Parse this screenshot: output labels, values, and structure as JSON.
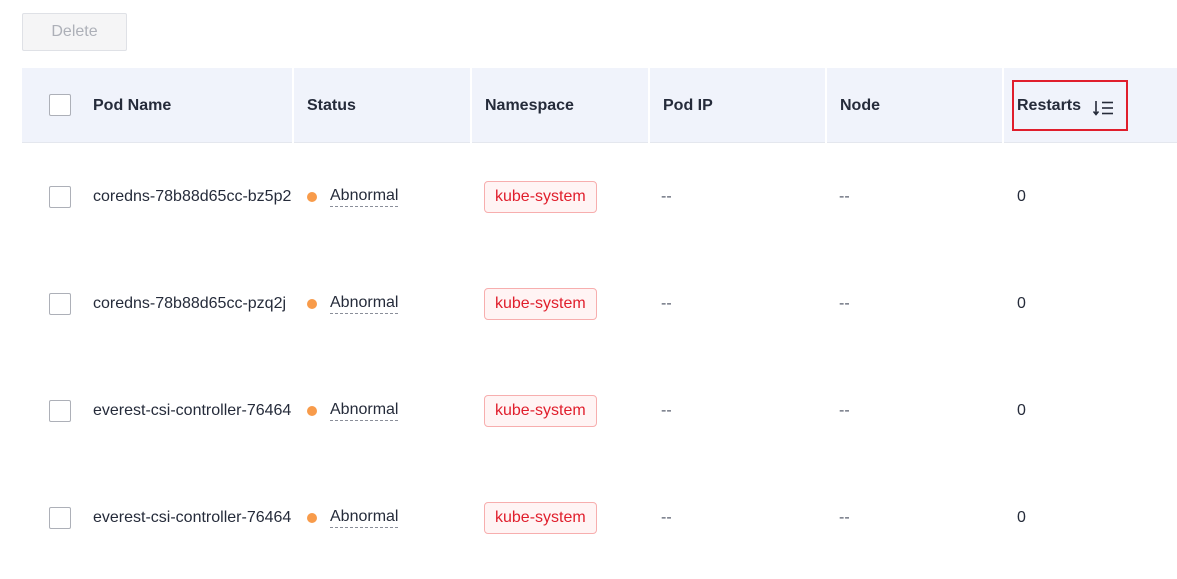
{
  "toolbar": {
    "delete_label": "Delete"
  },
  "table": {
    "columns": [
      "Pod Name",
      "Status",
      "Namespace",
      "Pod IP",
      "Node",
      "Restarts"
    ],
    "rows": [
      {
        "name": "coredns-78b88d65cc-bz5p2",
        "status": "Abnormal",
        "namespace": "kube-system",
        "pod_ip": "--",
        "node": "--",
        "restarts": "0"
      },
      {
        "name": "coredns-78b88d65cc-pzq2j",
        "status": "Abnormal",
        "namespace": "kube-system",
        "pod_ip": "--",
        "node": "--",
        "restarts": "0"
      },
      {
        "name": "everest-csi-controller-76464",
        "status": "Abnormal",
        "namespace": "kube-system",
        "pod_ip": "--",
        "node": "--",
        "restarts": "0"
      },
      {
        "name": "everest-csi-controller-76464",
        "status": "Abnormal",
        "namespace": "kube-system",
        "pod_ip": "--",
        "node": "--",
        "restarts": "0"
      }
    ]
  },
  "colors": {
    "abnormal_dot": "#f89b4a",
    "tag_red": "#e01e2c",
    "highlight": "#e01e2c",
    "header_bg": "#f0f3fb"
  },
  "icons": {
    "sort": "sort-descending-icon"
  }
}
